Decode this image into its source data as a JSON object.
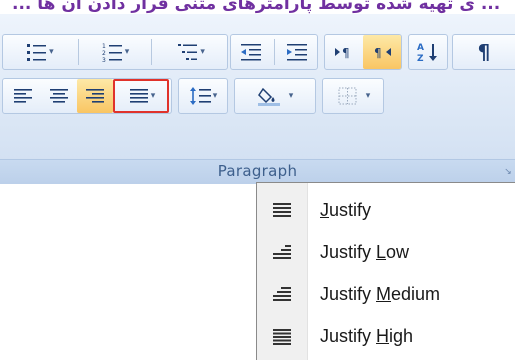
{
  "page": {
    "caption": "... ی تهیه شده توسط پارامترهای متنی قرار دادن آن ها ..."
  },
  "ribbon": {
    "group_label": "Paragraph",
    "launcher_glyph": "↘",
    "row1": [
      {
        "name": "bullets",
        "icon": "bullets-icon",
        "has_dropdown": true
      },
      {
        "name": "numbering",
        "icon": "numbering-icon",
        "has_dropdown": true
      },
      {
        "name": "multilevel-list",
        "icon": "multilevel-list-icon",
        "has_dropdown": true
      },
      {
        "name": "decrease-indent",
        "icon": "decrease-indent-icon",
        "has_dropdown": false
      },
      {
        "name": "increase-indent",
        "icon": "increase-indent-icon",
        "has_dropdown": false
      },
      {
        "name": "left-to-right",
        "icon": "ltr-paragraph-icon",
        "has_dropdown": false
      },
      {
        "name": "right-to-left",
        "icon": "rtl-paragraph-icon",
        "has_dropdown": false,
        "active": true
      },
      {
        "name": "sort",
        "icon": "sort-az-icon",
        "has_dropdown": false
      },
      {
        "name": "show-hide",
        "icon": "pilcrow-icon",
        "has_dropdown": false
      }
    ],
    "row2": [
      {
        "name": "align-left",
        "icon": "align-left-icon"
      },
      {
        "name": "center",
        "icon": "align-center-icon"
      },
      {
        "name": "align-right",
        "icon": "align-right-icon",
        "active": true
      },
      {
        "name": "justify",
        "icon": "justify-icon",
        "has_dropdown": true,
        "highlighted": true
      },
      {
        "name": "line-spacing",
        "icon": "line-spacing-icon",
        "has_dropdown": true
      },
      {
        "name": "shading",
        "icon": "shading-bucket-icon",
        "has_dropdown": true
      },
      {
        "name": "borders",
        "icon": "borders-icon",
        "has_dropdown": true
      }
    ],
    "sort_glyph_top": "A",
    "sort_glyph_bottom": "Z",
    "pilcrow": "¶",
    "dropdown_arrow": "▾"
  },
  "justify_menu": {
    "items": [
      {
        "pre": "",
        "mnemonic": "J",
        "post": "ustify",
        "icon": "justify-icon"
      },
      {
        "pre": "Justify ",
        "mnemonic": "L",
        "post": "ow",
        "icon": "justify-low-icon"
      },
      {
        "pre": "Justify ",
        "mnemonic": "M",
        "post": "edium",
        "icon": "justify-medium-icon"
      },
      {
        "pre": "Justify ",
        "mnemonic": "H",
        "post": "igh",
        "icon": "justify-high-icon"
      }
    ]
  }
}
